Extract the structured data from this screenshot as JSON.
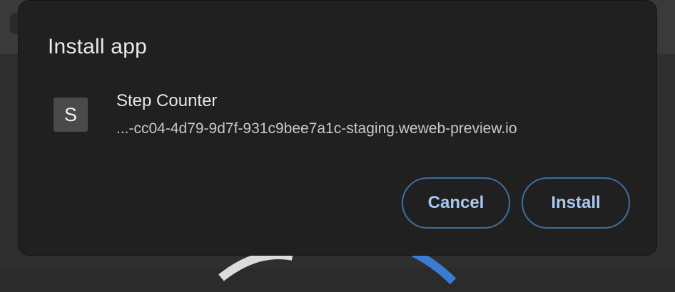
{
  "dialog": {
    "title": "Install app",
    "app": {
      "icon_letter": "S",
      "name": "Step Counter",
      "url": "...-cc04-4d79-9d7f-931c9bee7a1c-staging.weweb-preview.io"
    },
    "buttons": {
      "cancel_label": "Cancel",
      "install_label": "Install"
    }
  },
  "colors": {
    "dialog_bg": "#202020",
    "button_border": "#3f6f9d",
    "button_text": "#a9c8f0"
  }
}
